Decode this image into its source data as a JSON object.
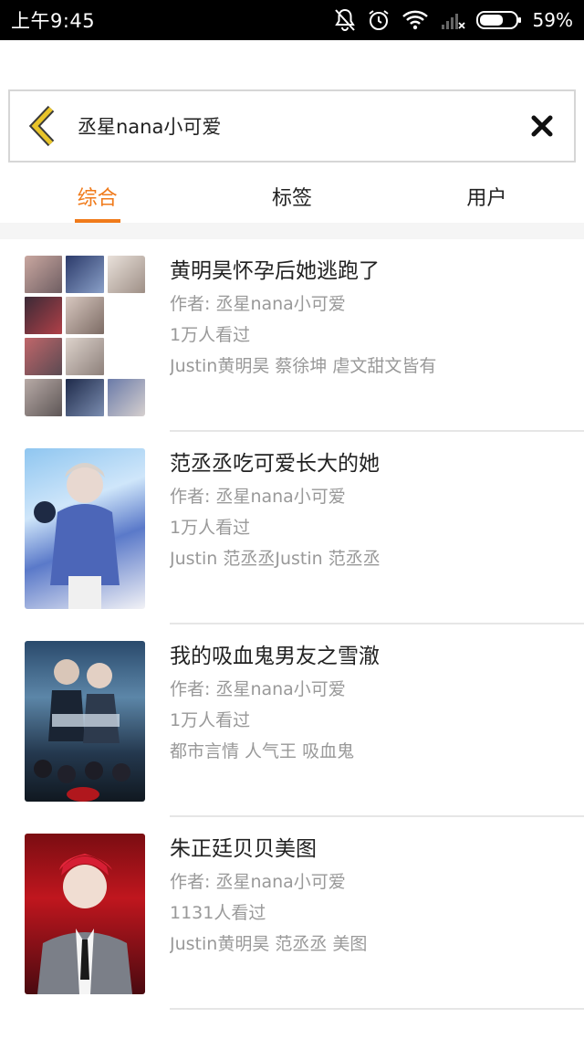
{
  "status_bar": {
    "time": "上午9:45",
    "battery": "59%"
  },
  "search": {
    "query": "丞星nana小可爱"
  },
  "tabs": [
    {
      "label": "综合",
      "active": true
    },
    {
      "label": "标签",
      "active": false
    },
    {
      "label": "用户",
      "active": false
    }
  ],
  "results": [
    {
      "title": "黄明昊怀孕后她逃跑了",
      "author": "作者: 丞星nana小可爱",
      "views": "1万人看过",
      "tags": "Justin黄明昊 蔡徐坤 虐文甜文皆有"
    },
    {
      "title": "范丞丞吃可爱长大的她",
      "author": "作者: 丞星nana小可爱",
      "views": "1万人看过",
      "tags": "Justin 范丞丞Justin 范丞丞"
    },
    {
      "title": "我的吸血鬼男友之雪澈",
      "author": "作者: 丞星nana小可爱",
      "views": "1万人看过",
      "tags": "都市言情 人气王 吸血鬼"
    },
    {
      "title": "朱正廷贝贝美图",
      "author": "作者: 丞星nana小可爱",
      "views": "1131人看过",
      "tags": "Justin黄明昊 范丞丞 美图"
    }
  ],
  "colors": {
    "accent": "#f07a1a",
    "muted_text": "#999999",
    "back_arrow": "#e8c42a"
  }
}
